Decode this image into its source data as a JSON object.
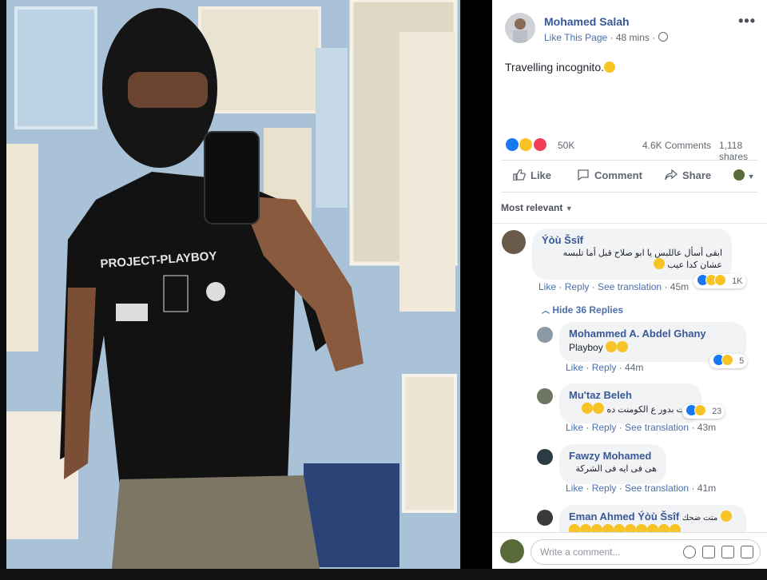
{
  "post": {
    "author": "Mohamed Salah",
    "like_page": "Like This Page",
    "separator": "·",
    "time": "48 mins",
    "text": "Travelling incognito.",
    "more": "•••"
  },
  "stats": {
    "reactions_count": "50K",
    "comments": "4.6K Comments",
    "shares": "1,118 shares"
  },
  "actions": {
    "like": "Like",
    "comment": "Comment",
    "share": "Share"
  },
  "sort": {
    "label": "Most relevant"
  },
  "comments": [
    {
      "name": "Ýòù Šsîf",
      "text": "ابقى أسأل عاللبس يا ابو صلاح قبل أما تلبسه عشان كدا عيب",
      "like": "Like",
      "reply": "Reply",
      "translate": "See translation",
      "time": "45m",
      "reactions": "1K",
      "hide_replies": "Hide 36 Replies"
    },
    {
      "name": "Mohammed A. Abdel Ghany",
      "text": "Playboy",
      "like": "Like",
      "reply": "Reply",
      "time": "44m",
      "reactions": "5"
    },
    {
      "name": "Mu'taz Beleh",
      "text": "كنت بدور ع الكومنت ده",
      "like": "Like",
      "reply": "Reply",
      "translate": "See translation",
      "time": "43m",
      "reactions": "23"
    },
    {
      "name": "Fawzy Mohamed",
      "text": "هى فى ايه فى الشركة",
      "like": "Like",
      "reply": "Reply",
      "translate": "See translation",
      "time": "41m"
    },
    {
      "name": "Eman Ahmed Ýòù Šsîf",
      "text": "متت ضحك"
    }
  ],
  "writer": {
    "placeholder": "Write a comment..."
  },
  "photo": {
    "shirt_text": "PROJECT-PLAYBOY"
  },
  "colors": {
    "link": "#365899",
    "like_blue": "#1877f2",
    "haha_yellow": "#f7c325",
    "love_red": "#f33e58"
  }
}
